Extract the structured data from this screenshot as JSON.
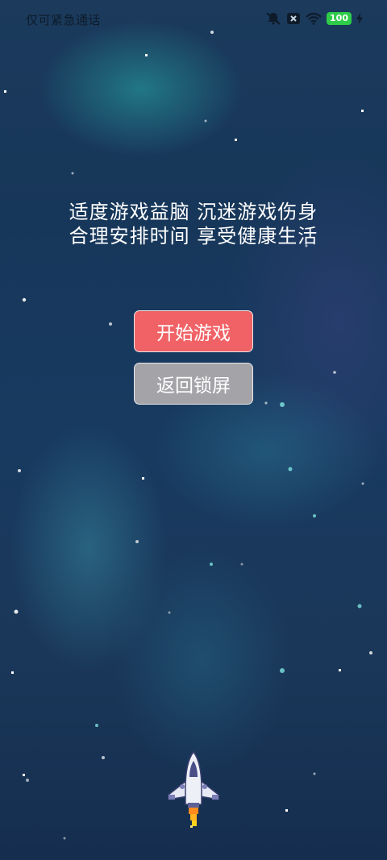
{
  "status_bar": {
    "carrier": "仅可紧急通话",
    "battery": "100"
  },
  "notice": {
    "line1": "适度游戏益脑  沉迷游戏伤身",
    "line2": "合理安排时间  享受健康生活"
  },
  "buttons": {
    "start": "开始游戏",
    "back": "返回锁屏"
  },
  "colors": {
    "start_button": "#f06266",
    "back_button": "#a4a3a8",
    "battery": "#2ecc48"
  }
}
